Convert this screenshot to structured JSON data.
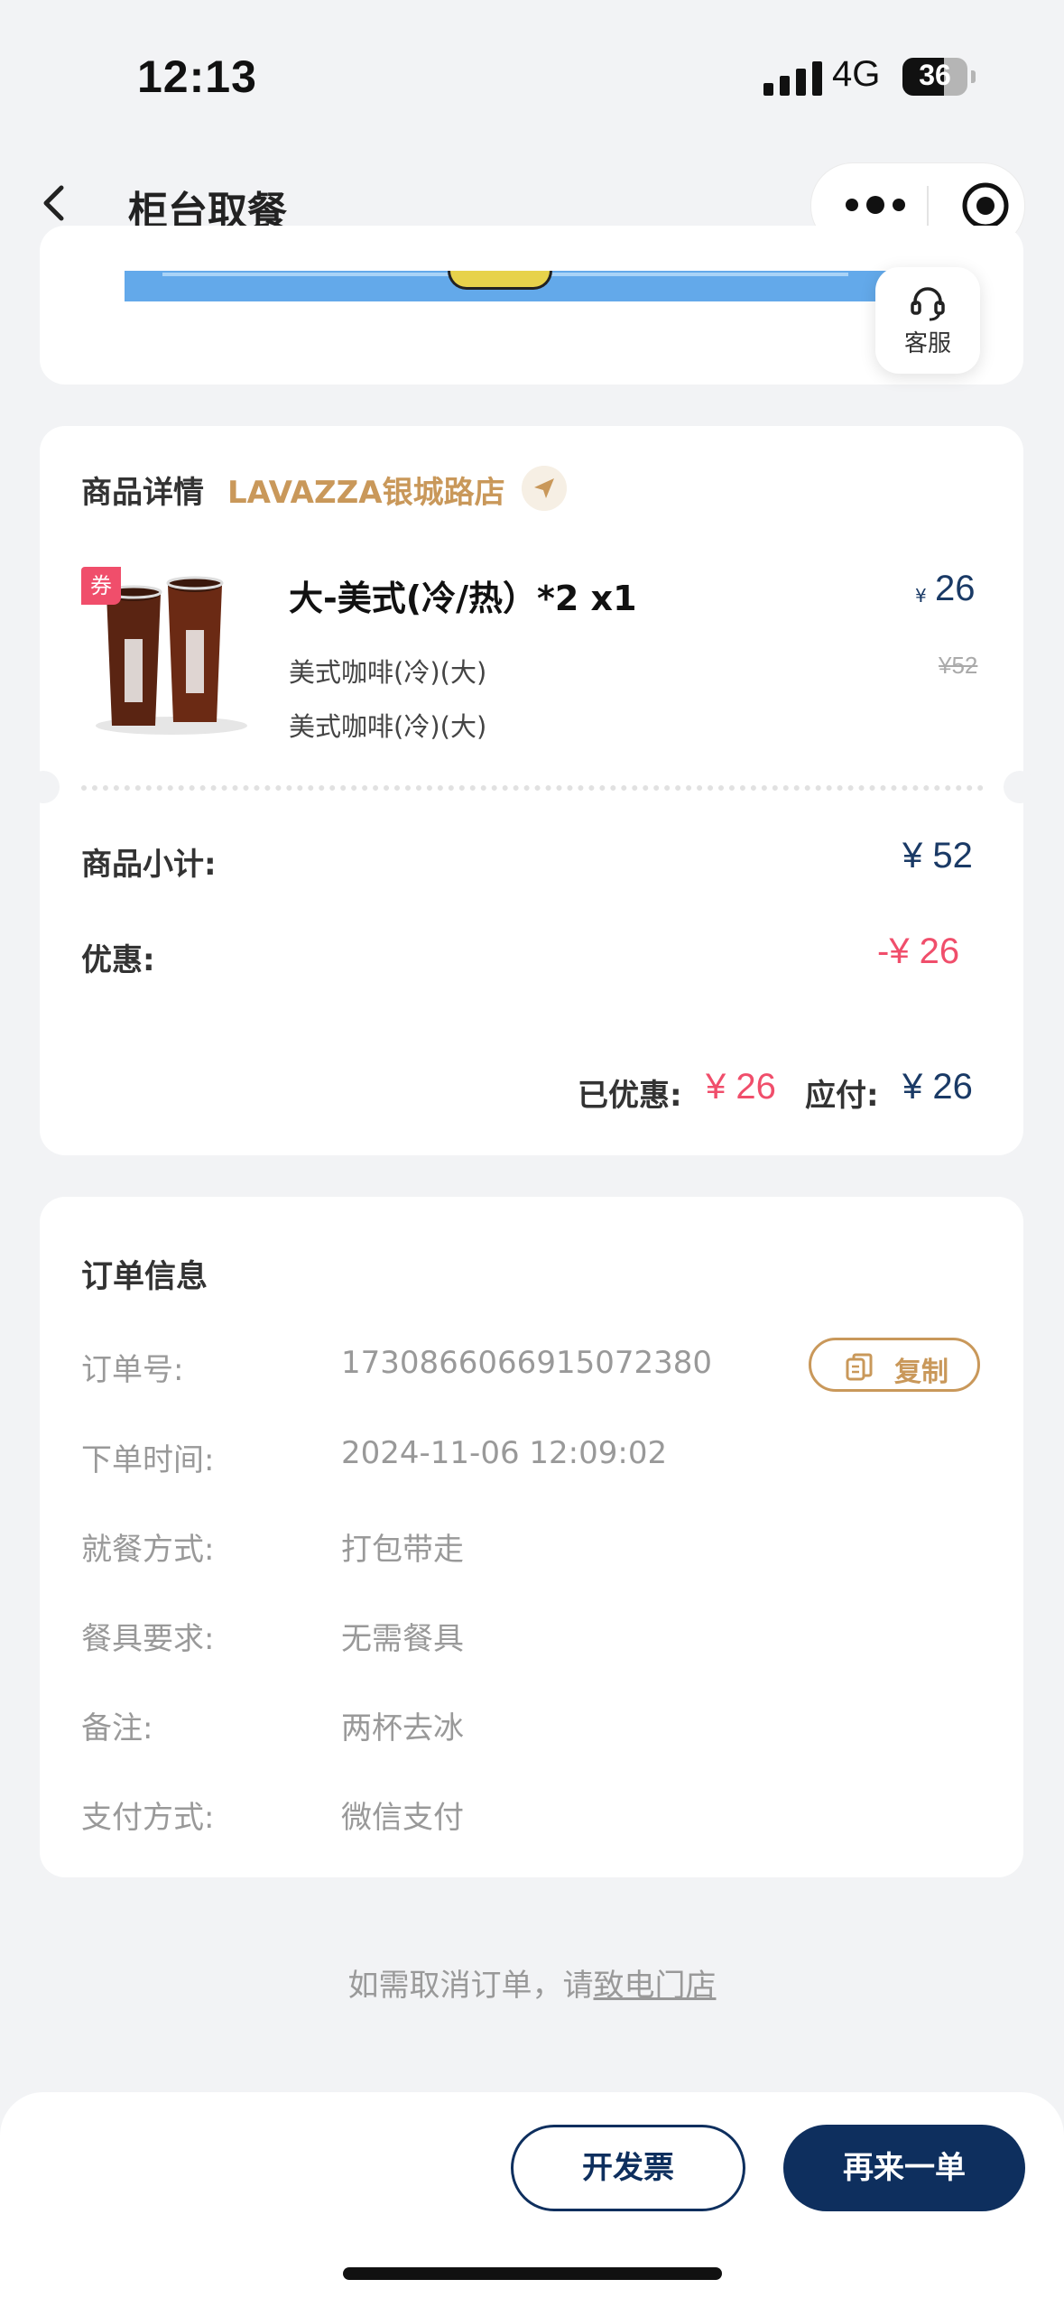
{
  "status_bar": {
    "time": "12:13",
    "network": "4G",
    "battery": "36"
  },
  "nav": {
    "title": "柜台取餐",
    "back_icon": "chevron-left-icon",
    "more_icon": "more-dots-icon",
    "close_icon": "mini-program-close-icon"
  },
  "service": {
    "label": "客服",
    "icon": "headset-icon"
  },
  "product": {
    "section_title": "商品详情",
    "store_name": "LAVAZZA银城路店",
    "coupon_tag": "券",
    "item_name": "大-美式(冷/热）*2 x1",
    "sub_items": [
      "美式咖啡(冷)(大)",
      "美式咖啡(冷)(大)"
    ],
    "currency": "¥",
    "price": "26",
    "original_price": "¥52",
    "subtotal_label": "商品小计:",
    "subtotal_value": "¥ 52",
    "discount_label": "优惠:",
    "discount_value": "-¥ 26",
    "saved_label": "已优惠:",
    "saved_value": "¥ 26",
    "payable_label": "应付:",
    "payable_value": "¥ 26"
  },
  "order_info": {
    "title": "订单信息",
    "copy_label": "复制",
    "rows": [
      {
        "label": "订单号:",
        "value": "1730866066915072380"
      },
      {
        "label": "下单时间:",
        "value": "2024-11-06 12:09:02"
      },
      {
        "label": "就餐方式:",
        "value": "打包带走"
      },
      {
        "label": "餐具要求:",
        "value": "无需餐具"
      },
      {
        "label": "备注:",
        "value": "两杯去冰"
      },
      {
        "label": "支付方式:",
        "value": "微信支付"
      }
    ]
  },
  "cancel_note": {
    "text": "如需取消订单，请",
    "link": "致电门店"
  },
  "actions": {
    "invoice": "开发票",
    "reorder": "再来一单"
  },
  "colors": {
    "navy": "#0e2f5e",
    "gold": "#c9985a",
    "red": "#f04e6b",
    "background": "#f2f3f5"
  }
}
